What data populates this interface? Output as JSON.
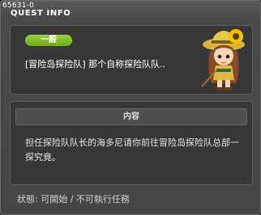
{
  "header": {
    "quest_id": "65631-0",
    "title": "QUEST INFO"
  },
  "quest": {
    "category": "一般",
    "name": "[冒险岛探险队] 那个自称探险队队.."
  },
  "content": {
    "header": "内容",
    "body": "担任探险队队长的海多尼请你前往冒险岛探险队总部一探究竟。"
  },
  "status": {
    "text": "狀態: 可開始 / 不可執行任務"
  },
  "npc": {
    "icon": "npc-portrait-explorer-girl",
    "hat_color": "#e8c84a",
    "flower_color": "#f2c200",
    "hair_color": "#8a4a22"
  }
}
